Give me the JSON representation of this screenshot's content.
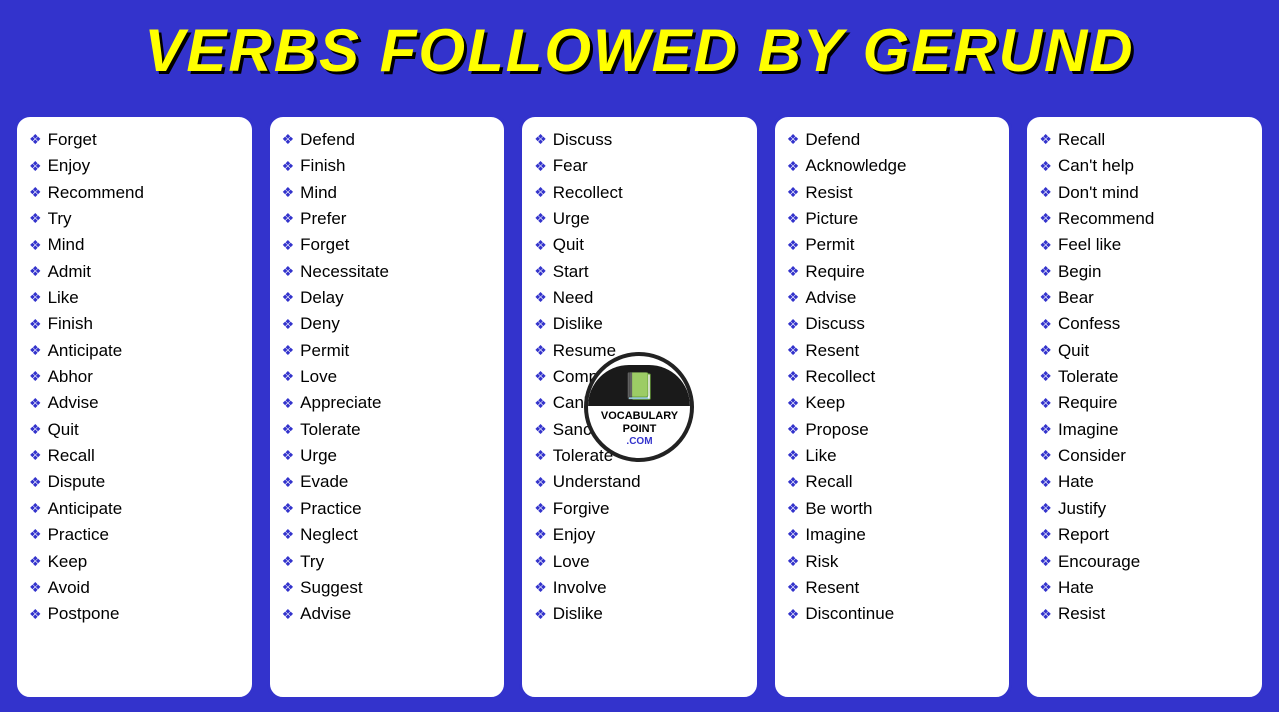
{
  "header": {
    "title": "VERBS FOLLOWED BY GERUND"
  },
  "columns": [
    {
      "id": "col1",
      "words": [
        "Forget",
        "Enjoy",
        "Recommend",
        "Try",
        "Mind",
        "Admit",
        "Like",
        "Finish",
        "Anticipate",
        "Abhor",
        "Advise",
        "Quit",
        "Recall",
        "Dispute",
        "Anticipate",
        "Practice",
        "Keep",
        "Avoid",
        "Postpone"
      ]
    },
    {
      "id": "col2",
      "words": [
        "Defend",
        "Finish",
        "Mind",
        "Prefer",
        "Forget",
        "Necessitate",
        "Delay",
        "Deny",
        "Permit",
        "Love",
        "Appreciate",
        "Tolerate",
        "Urge",
        "Evade",
        "Practice",
        "Neglect",
        "Try",
        "Suggest",
        "Advise"
      ]
    },
    {
      "id": "col3",
      "words": [
        "Discuss",
        "Fear",
        "Recollect",
        "Urge",
        "Quit",
        "Start",
        "Need",
        "Dislike",
        "Resume",
        "Complete",
        "Can't help",
        "Sanction",
        "Tolerate",
        "Understand",
        "Forgive",
        "Enjoy",
        "Love",
        "Involve",
        "Dislike"
      ],
      "has_logo": true
    },
    {
      "id": "col4",
      "words": [
        "Defend",
        "Acknowledge",
        "Resist",
        "Picture",
        "Permit",
        "Require",
        "Advise",
        "Discuss",
        "Resent",
        "Recollect",
        "Keep",
        "Propose",
        "Like",
        "Recall",
        "Be worth",
        "Imagine",
        "Risk",
        "Resent",
        "Discontinue"
      ]
    },
    {
      "id": "col5",
      "words": [
        "Recall",
        "Can't help",
        "Don't mind",
        "Recommend",
        "Feel like",
        "Begin",
        "Bear",
        "Confess",
        "Quit",
        "Tolerate",
        "Require",
        "Imagine",
        "Consider",
        "Hate",
        "Justify",
        "Report",
        "Encourage",
        "Hate",
        "Resist"
      ]
    }
  ],
  "diamond_symbol": "❖"
}
